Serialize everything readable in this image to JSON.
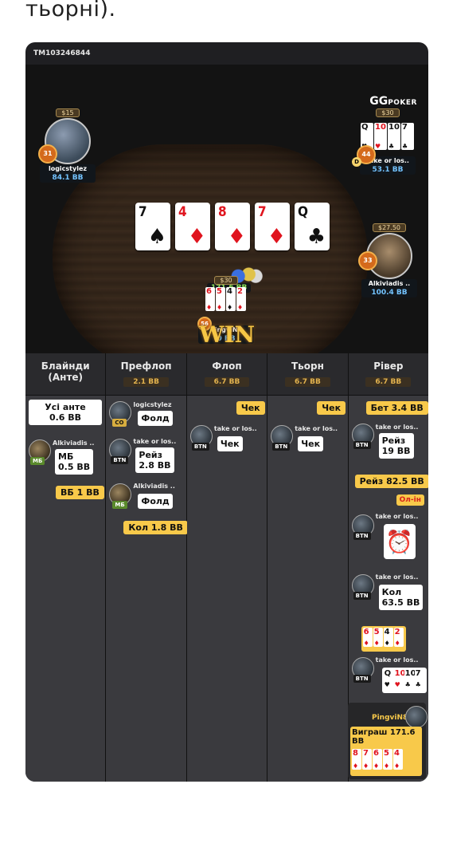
{
  "top_text": "тьорні).",
  "hand_id": "TM103246844",
  "logo": {
    "gg": "GG",
    "poker": "POKER"
  },
  "board": [
    {
      "rank": "7",
      "suit": "♠",
      "color": "blk"
    },
    {
      "rank": "4",
      "suit": "♦",
      "color": "red"
    },
    {
      "rank": "8",
      "suit": "♦",
      "color": "red"
    },
    {
      "rank": "7",
      "suit": "♦",
      "color": "red"
    },
    {
      "rank": "Q",
      "suit": "♣",
      "color": "blk"
    }
  ],
  "pot": "171.6 BB",
  "win_text": "WIN",
  "players": {
    "logicstylez": {
      "name": "logicstylez",
      "stack": "84.1 BB",
      "bet": "$15",
      "level": "31"
    },
    "takeorlose": {
      "name": "take or los..",
      "stack": "53.1 BB",
      "bet": "$30",
      "level": "44",
      "dealer": "D",
      "cards": [
        {
          "rank": "Q",
          "suit": "♥",
          "color": "blk"
        },
        {
          "rank": "10",
          "suit": "♥",
          "color": "red"
        },
        {
          "rank": "10",
          "suit": "♣",
          "color": "blk"
        },
        {
          "rank": "7",
          "suit": "♣",
          "color": "blk"
        }
      ]
    },
    "alkiviadis": {
      "name": "Alkiviadis ..",
      "stack": "100.4 BB",
      "bet": "$27.50",
      "level": "33"
    },
    "pingvin": {
      "name": "PingviN8",
      "stack": "0 BB",
      "bet": "$30",
      "level": "56",
      "cards": [
        {
          "rank": "6",
          "suit": "♦",
          "color": "red"
        },
        {
          "rank": "5",
          "suit": "♦",
          "color": "red"
        },
        {
          "rank": "4",
          "suit": "♦",
          "color": "blk"
        },
        {
          "rank": "2",
          "suit": "♦",
          "color": "red"
        }
      ]
    }
  },
  "columns": [
    {
      "title": "Блайнди (Анте)",
      "pot": ""
    },
    {
      "title": "Префлоп",
      "pot": "2.1 BB"
    },
    {
      "title": "Флоп",
      "pot": "6.7 BB"
    },
    {
      "title": "Тьорн",
      "pot": "6.7 BB"
    },
    {
      "title": "Рівер",
      "pot": "6.7 BB"
    }
  ],
  "blinds": {
    "ante_l1": "Усі анте",
    "ante_l2": "0.6 BB",
    "sb_name": "Alkiviadis ..",
    "sb_pos": "МБ",
    "sb_l1": "МБ",
    "sb_l2": "0.5 BB",
    "bb": "ВБ 1 BB"
  },
  "preflop": {
    "p1_name": "logicstylez",
    "p1_pos": "CO",
    "p1_act": "Фолд",
    "p2_name": "take or los..",
    "p2_pos": "BTN",
    "p2_l1": "Рейз",
    "p2_l2": "2.8 BB",
    "p3_name": "Alkiviadis ..",
    "p3_pos": "МБ",
    "p3_act": "Фолд",
    "call": "Кол 1.8 BB"
  },
  "flop": {
    "check1": "Чек",
    "name": "take or los..",
    "pos": "BTN",
    "check2": "Чек"
  },
  "turn": {
    "check1": "Чек",
    "name": "take or los..",
    "pos": "BTN",
    "check2": "Чек"
  },
  "river": {
    "bet": "Бет 3.4 BB",
    "n1": "take or los..",
    "pos1": "BTN",
    "raise_l1": "Рейз",
    "raise_l2": "19 BB",
    "reraise": "Рейз 82.5 BB",
    "allin": "Ол-ін",
    "n2": "take or los..",
    "pos2": "BTN",
    "n3": "take or los..",
    "pos3": "BTN",
    "call_l1": "Кол",
    "call_l2": "63.5 BB",
    "hero_cards": [
      {
        "rank": "6",
        "suit": "♦",
        "color": "red"
      },
      {
        "rank": "5",
        "suit": "♦",
        "color": "red"
      },
      {
        "rank": "4",
        "suit": "♦",
        "color": "blk"
      },
      {
        "rank": "2",
        "suit": "♦",
        "color": "red"
      }
    ],
    "n4": "take or los..",
    "pos4": "BTN",
    "villain_cards": [
      {
        "rank": "Q",
        "suit": "♥",
        "color": "blk"
      },
      {
        "rank": "10",
        "suit": "♥",
        "color": "red"
      },
      {
        "rank": "10",
        "suit": "♣",
        "color": "blk"
      },
      {
        "rank": "7",
        "suit": "♣",
        "color": "blk"
      }
    ],
    "winner": "PingviN8",
    "win_label": "Виграш 171.6 BB",
    "win_cards": [
      {
        "rank": "8",
        "suit": "♦",
        "color": "red"
      },
      {
        "rank": "7",
        "suit": "♦",
        "color": "red"
      },
      {
        "rank": "6",
        "suit": "♦",
        "color": "red"
      },
      {
        "rank": "5",
        "suit": "♦",
        "color": "red"
      },
      {
        "rank": "4",
        "suit": "♦",
        "color": "red"
      }
    ]
  }
}
